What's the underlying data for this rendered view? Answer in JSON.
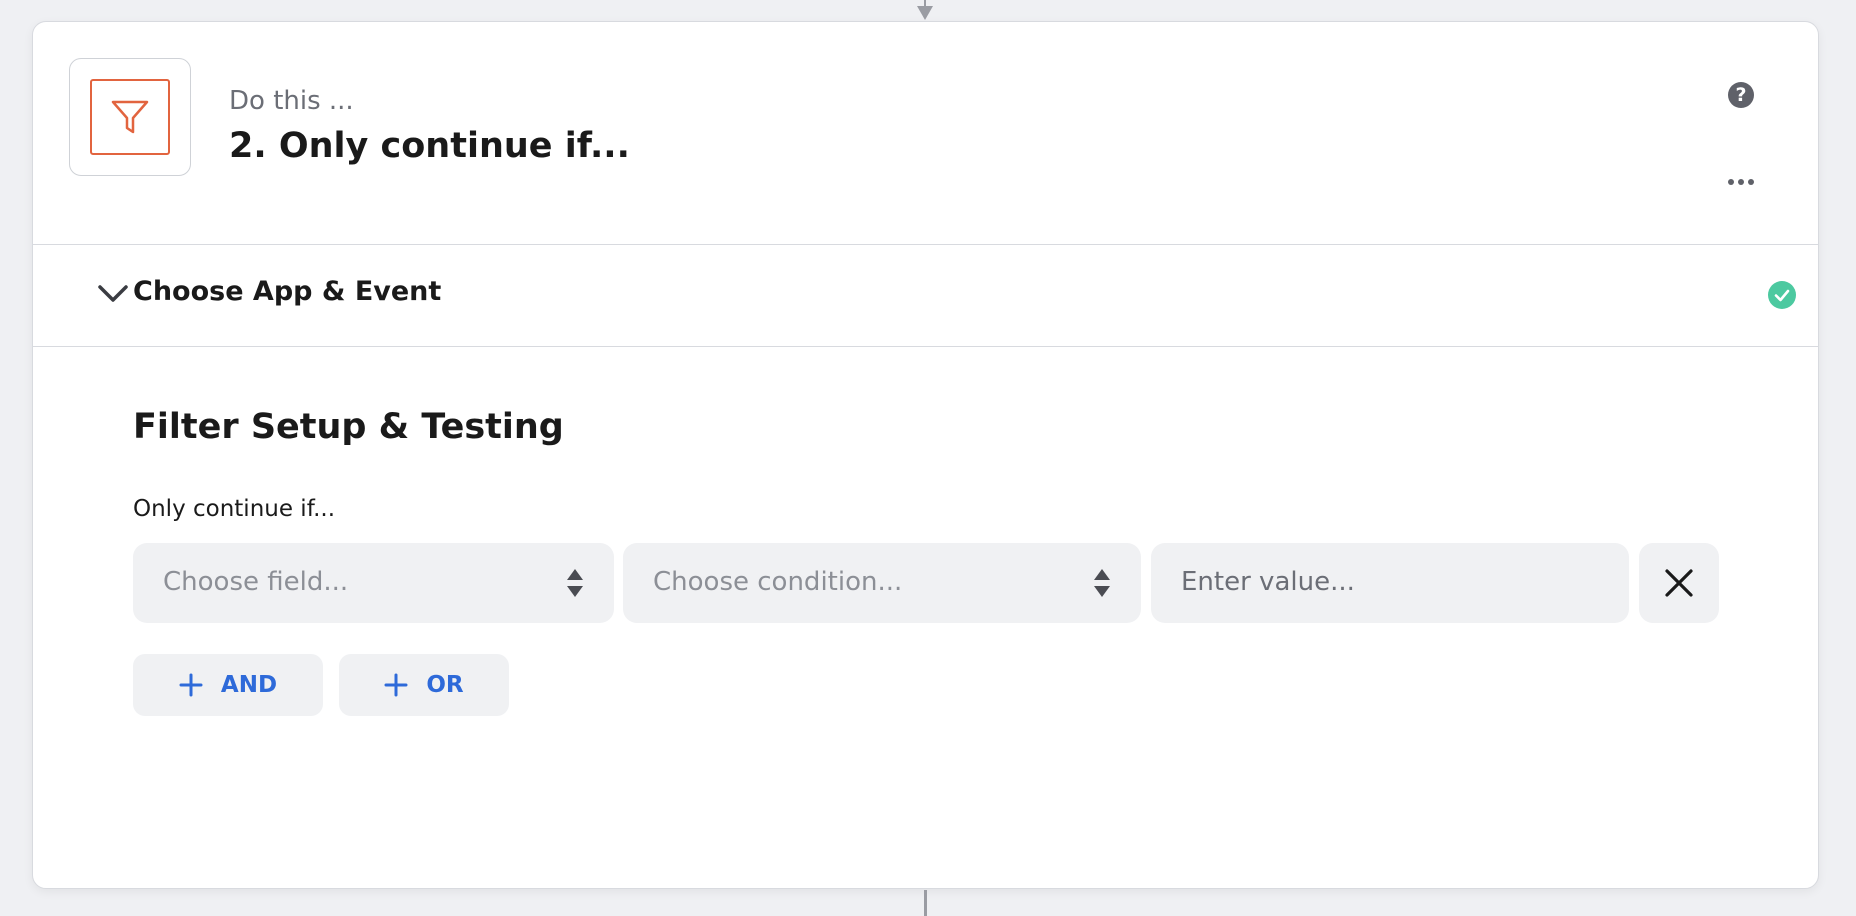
{
  "step": {
    "subtitle": "Do this ...",
    "title": "2. Only continue if..."
  },
  "icons": {
    "app": "filter-funnel-icon",
    "help": "question-icon",
    "more": "more-horizontal-icon",
    "chevron": "chevron-down-icon",
    "status": "check-circle-icon",
    "stepper": "up-down-stepper-icon",
    "remove": "close-icon",
    "add": "plus-icon"
  },
  "help": {
    "glyph": "?"
  },
  "section": {
    "label": "Choose App & Event",
    "status": "complete"
  },
  "filter": {
    "title": "Filter Setup & Testing",
    "condition_label": "Only continue if...",
    "field_placeholder": "Choose field...",
    "condition_placeholder": "Choose condition...",
    "value_placeholder": "Enter value...",
    "and_label": "AND",
    "or_label": "OR"
  },
  "colors": {
    "accent": "#e2643f",
    "link": "#2e6ad9",
    "success": "#4cc9a0"
  }
}
